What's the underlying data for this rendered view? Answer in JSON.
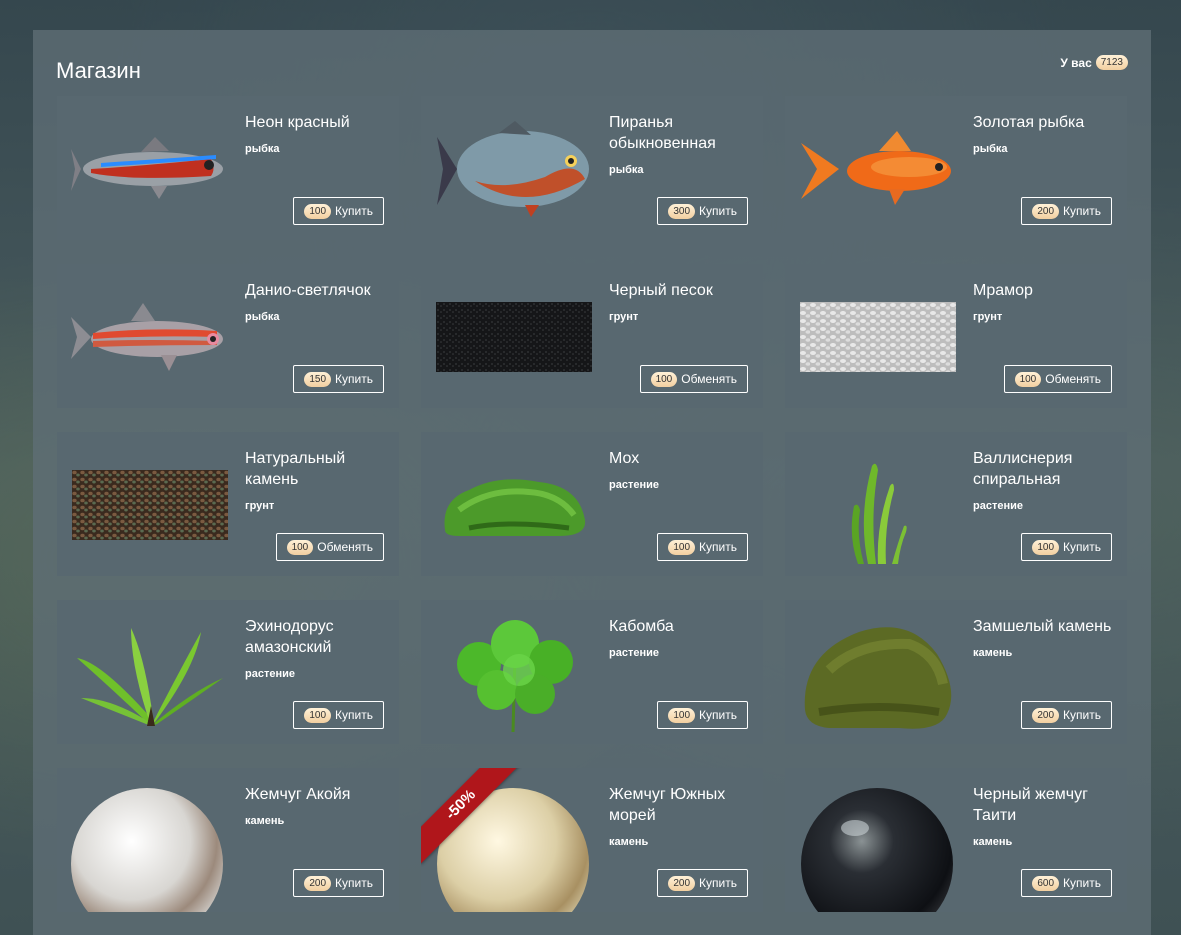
{
  "shop": {
    "title": "Магазин",
    "balance_label": "У вас",
    "balance_value": "7123"
  },
  "items": [
    {
      "name": "Неон красный",
      "category": "рыбка",
      "price": "100",
      "action": "Купить",
      "icon": "neon-fish-icon"
    },
    {
      "name": "Пиранья обыкновенная",
      "category": "рыбка",
      "price": "300",
      "action": "Купить",
      "icon": "piranha-icon"
    },
    {
      "name": "Золотая рыбка",
      "category": "рыбка",
      "price": "200",
      "action": "Купить",
      "icon": "goldfish-icon"
    },
    {
      "name": "Данио-светлячок",
      "category": "рыбка",
      "price": "150",
      "action": "Купить",
      "icon": "danio-fish-icon"
    },
    {
      "name": "Черный песок",
      "category": "грунт",
      "price": "100",
      "action": "Обменять",
      "icon": "black-sand-icon"
    },
    {
      "name": "Мрамор",
      "category": "грунт",
      "price": "100",
      "action": "Обменять",
      "icon": "marble-gravel-icon"
    },
    {
      "name": "Натуральный камень",
      "category": "грунт",
      "price": "100",
      "action": "Обменять",
      "icon": "natural-stone-gravel-icon"
    },
    {
      "name": "Мох",
      "category": "растение",
      "price": "100",
      "action": "Купить",
      "icon": "moss-icon"
    },
    {
      "name": "Валлиснерия спиральная",
      "category": "растение",
      "price": "100",
      "action": "Купить",
      "icon": "vallisneria-icon"
    },
    {
      "name": "Эхинодорус амазонский",
      "category": "растение",
      "price": "100",
      "action": "Купить",
      "icon": "echinodorus-icon"
    },
    {
      "name": "Кабомба",
      "category": "растение",
      "price": "100",
      "action": "Купить",
      "icon": "cabomba-icon"
    },
    {
      "name": "Замшелый камень",
      "category": "камень",
      "price": "200",
      "action": "Купить",
      "icon": "mossy-stone-icon"
    },
    {
      "name": "Жемчуг Акойя",
      "category": "камень",
      "price": "200",
      "action": "Купить",
      "icon": "akoya-pearl-icon"
    },
    {
      "name": "Жемчуг Южных морей",
      "category": "камень",
      "price": "200",
      "action": "Купить",
      "icon": "south-sea-pearl-icon",
      "badge": "-50%"
    },
    {
      "name": "Черный жемчуг Таити",
      "category": "камень",
      "price": "600",
      "action": "Купить",
      "icon": "tahitian-pearl-icon"
    }
  ],
  "colors": {
    "badge": "#b0161b",
    "coin": "#f2cfa0"
  }
}
